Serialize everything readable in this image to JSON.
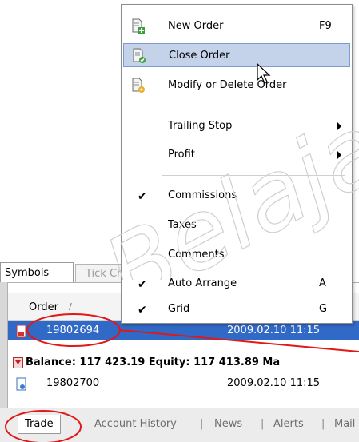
{
  "panel_tabs": {
    "symbols": "Symbols",
    "tick_chart": "Tick Chart"
  },
  "table": {
    "header_order": "Order",
    "header_sort_glyph": "/",
    "rows": [
      {
        "order": "19802694",
        "time": "2009.02.10 11:15"
      },
      {
        "summary": "Balance: 117 423.19  Equity: 117 413.89  Ma"
      },
      {
        "order": "19802700",
        "time": "2009.02.10 11:15"
      }
    ]
  },
  "bottom_tabs": {
    "trade": "Trade",
    "account_history": "Account History",
    "news": "News",
    "alerts": "Alerts",
    "mailbox": "Mail",
    "separator": "|"
  },
  "context_menu": {
    "new_order": {
      "label": "New Order",
      "shortcut": "F9"
    },
    "close_order": {
      "label": "Close Order"
    },
    "modify_delete": {
      "label": "Modify or Delete Order"
    },
    "trailing_stop": {
      "label": "Trailing Stop"
    },
    "profit": {
      "label": "Profit"
    },
    "commissions": {
      "label": "Commissions"
    },
    "taxes": {
      "label": "Taxes"
    },
    "comments": {
      "label": "Comments"
    },
    "auto_arrange": {
      "label": "Auto Arrange",
      "shortcut": "A"
    },
    "grid": {
      "label": "Grid",
      "shortcut": "G"
    }
  },
  "icons": {
    "new_order": "document-plus-icon",
    "close_order": "document-close-icon",
    "modify_order": "document-edit-icon",
    "check": "checkmark-icon",
    "submenu": "submenu-arrow-icon",
    "order_row": "order-icon"
  },
  "colors": {
    "selection": "#3169c6",
    "menu_highlight": "#c4d2ea",
    "annotation": "#e01818"
  },
  "watermark": "Belajar"
}
